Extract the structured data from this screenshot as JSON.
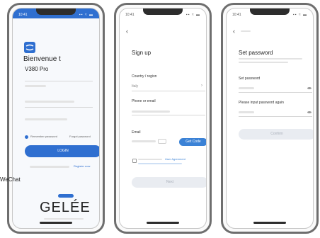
{
  "login": {
    "status_time": "10:41",
    "status_icons": "▪▪ ≈ ▬",
    "welcome": "Bienvenue t",
    "app_name": "V380 Pro",
    "remember_label": "Remember password",
    "forgot_label": "Forgot password",
    "login_button": "LOGIN",
    "register_link": "Register now",
    "wechat_label": "WeChat",
    "brand_text": "GELÉE",
    "brand_color": "#1f5fbf"
  },
  "signup": {
    "status_time": "10:41",
    "status_icons": "▪▪ ≈ ▬",
    "back": "‹",
    "title": "Sign up",
    "country_label": "Country / region",
    "country_value": "Italy",
    "phone_label": "Phone or email",
    "email_label": "Email",
    "get_code_button": "Get Code",
    "agreement_link": "User Agreement",
    "sign_up_button": "Next",
    "accent_color": "#3b82d6"
  },
  "setpassword": {
    "status_time": "10:41",
    "status_icons": "▪▪ ≈ ▬",
    "back": "‹",
    "title": "Set password",
    "password_label": "Set password",
    "confirm_label": "Please input password again",
    "confirm_button": "Confirm"
  }
}
